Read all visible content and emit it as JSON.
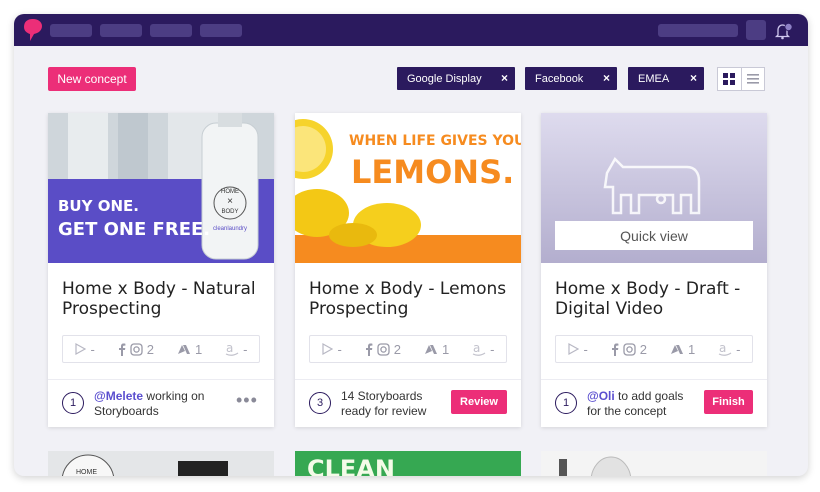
{
  "toolbar": {
    "new_concept_label": "New concept",
    "filters": [
      {
        "label": "Google Display",
        "remove": "×"
      },
      {
        "label": "Facebook",
        "remove": "×"
      },
      {
        "label": "EMEA",
        "remove": "×"
      }
    ]
  },
  "colors": {
    "brand": "#2b1a5e",
    "accent": "#ec2e78",
    "mention": "#5b4fcf"
  },
  "cards": [
    {
      "title": "Home x Body - Natural Prospecting",
      "thumb": {
        "headline_1": "BUY ONE.",
        "headline_2": "GET ONE FREE.",
        "bottle_1": "HOME",
        "bottle_2": "×",
        "bottle_3": "BODY",
        "bottle_4": "cleanlaundry"
      },
      "stats": {
        "display": "-",
        "facebook": "2",
        "adwords": "1",
        "amazon": "-"
      },
      "step": "1",
      "mention": "@Melete",
      "footer_text": " working on Storyboards",
      "more": "•••"
    },
    {
      "title": "Home x Body - Lemons Prospecting",
      "thumb": {
        "headline_1": "WHEN LIFE GIVES YOU",
        "headline_2": "LEMONS."
      },
      "stats": {
        "display": "-",
        "facebook": "2",
        "adwords": "1",
        "amazon": "-"
      },
      "step": "3",
      "footer_text": "14 Storyboards ready for review",
      "action": "Review"
    },
    {
      "title": "Home x Body - Draft - Digital Video",
      "thumb": {
        "quick_view": "Quick view"
      },
      "stats": {
        "display": "-",
        "facebook": "2",
        "adwords": "1",
        "amazon": "-"
      },
      "step": "1",
      "mention": "@Oli",
      "footer_text": " to add goals for the concept",
      "action": "Finish"
    }
  ],
  "row2": {
    "card1_text": "HOME",
    "card2_text": "CLEAN"
  },
  "icons": [
    "app-logo-icon",
    "bell-icon",
    "grid-view-icon",
    "list-view-icon",
    "play-icon",
    "facebook-icon",
    "instagram-icon",
    "adwords-icon",
    "amazon-icon",
    "cow-icon"
  ]
}
